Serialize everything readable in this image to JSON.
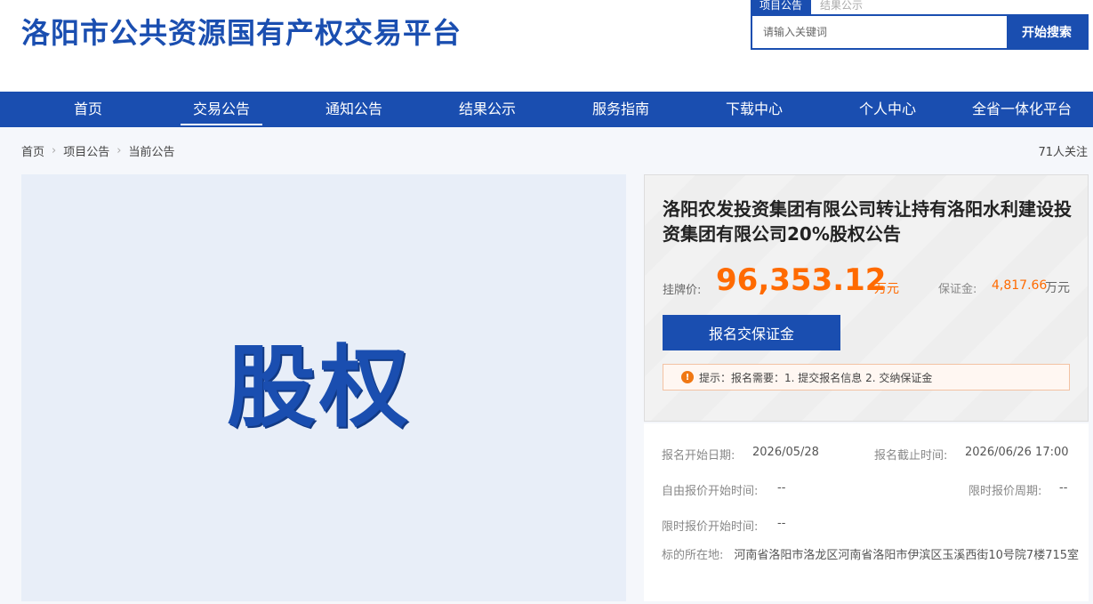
{
  "header": {
    "site_title": "洛阳市公共资源国有产权交易平台"
  },
  "search": {
    "tabs": [
      {
        "label": "项目公告",
        "active": true
      },
      {
        "label": "结果公示",
        "active": false
      }
    ],
    "placeholder": "请输入关键词",
    "button_label": "开始搜索"
  },
  "nav": {
    "items": [
      {
        "label": "首页",
        "active": false
      },
      {
        "label": "交易公告",
        "active": true
      },
      {
        "label": "通知公告",
        "active": false
      },
      {
        "label": "结果公示",
        "active": false
      },
      {
        "label": "服务指南",
        "active": false
      },
      {
        "label": "下载中心",
        "active": false
      },
      {
        "label": "个人中心",
        "active": false
      },
      {
        "label": "全省一体化平台",
        "active": false
      }
    ]
  },
  "breadcrumb": {
    "items": [
      "首页",
      "项目公告",
      "当前公告"
    ],
    "followers": "71人关注"
  },
  "image": {
    "text": "股权"
  },
  "project": {
    "title": "洛阳农发投资集团有限公司转让持有洛阳水利建设投资集团有限公司20%股权公告",
    "price_label": "挂牌价:",
    "price_value": "96,353.12",
    "price_unit": "万元",
    "deposit_label": "保证金:",
    "deposit_value": "4,817.66",
    "deposit_unit": "万元",
    "apply_button": "报名交保证金",
    "tip_text": "提示：报名需要：1. 提交报名信息 2. 交纳保证金"
  },
  "details": {
    "signup_start_label": "报名开始日期:",
    "signup_start_value": "2026/05/28",
    "signup_end_label": "报名截止时间:",
    "signup_end_value": "2026/06/26 17:00",
    "free_bid_start_label": "自由报价开始时间:",
    "free_bid_start_value": "--",
    "timed_bid_period_label": "限时报价周期:",
    "timed_bid_period_value": "--",
    "timed_bid_start_label": "限时报价开始时间:",
    "timed_bid_start_value": "--",
    "location_label": "标的所在地:",
    "location_value": "河南省洛阳市洛龙区河南省洛阳市伊滨区玉溪西街10号院7楼715室"
  },
  "colors": {
    "brand_blue": "#1a4eb0",
    "price_orange": "#ff6a00"
  }
}
